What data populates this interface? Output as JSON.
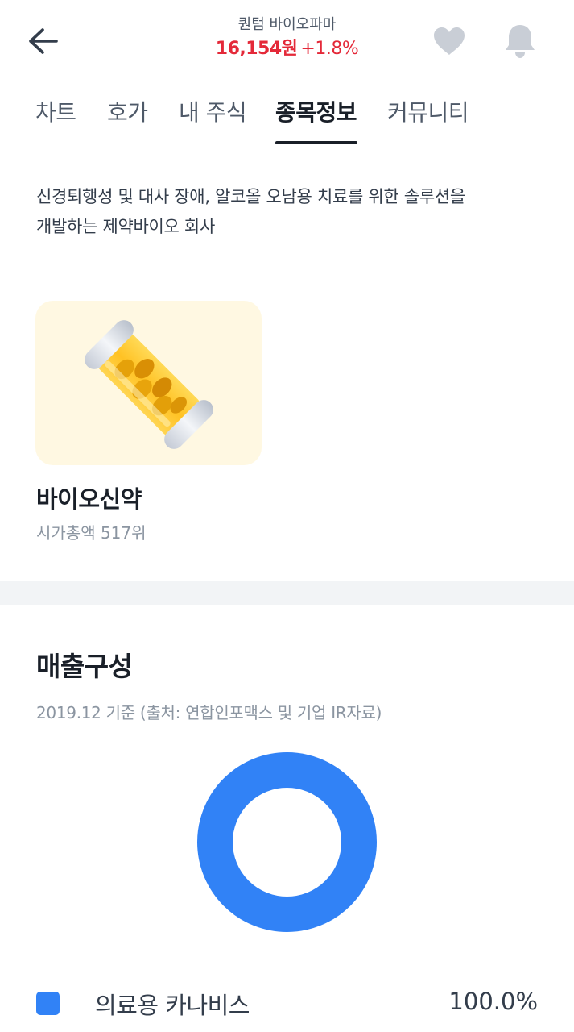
{
  "header": {
    "stock_name": "퀀텀 바이오파마",
    "price": "16,154원",
    "change": "+1.8%",
    "price_color": "#e42939"
  },
  "tabs": [
    {
      "label": "차트",
      "active": false
    },
    {
      "label": "호가",
      "active": false
    },
    {
      "label": "내 주식",
      "active": false
    },
    {
      "label": "종목정보",
      "active": true
    },
    {
      "label": "커뮤니티",
      "active": false
    }
  ],
  "company": {
    "description_line1": "신경퇴행성 및 대사 장애, 알코올 오남용 치료를 위한 솔루션을",
    "description_line2": "개발하는 제약바이오 회사"
  },
  "category": {
    "icon": "pill-capsule-icon",
    "title": "바이오신약",
    "rank": "시가총액 517위",
    "card_bg": "#fff8e2"
  },
  "revenue": {
    "title": "매출구성",
    "source": "2019.12 기준 (출처: 연합인포맥스 및 기업 IR자료)"
  },
  "chart_data": {
    "type": "pie",
    "categories": [
      "의료용 카나비스"
    ],
    "values": [
      100.0
    ],
    "colors": [
      "#3182f6"
    ],
    "labels": [
      "100.0%"
    ]
  },
  "icons": {
    "back": "arrow-left-icon",
    "favorite": "heart-icon",
    "alert": "bell-icon"
  },
  "colors": {
    "accent_blue": "#3182f6",
    "icon_gray": "#c9ced6"
  }
}
